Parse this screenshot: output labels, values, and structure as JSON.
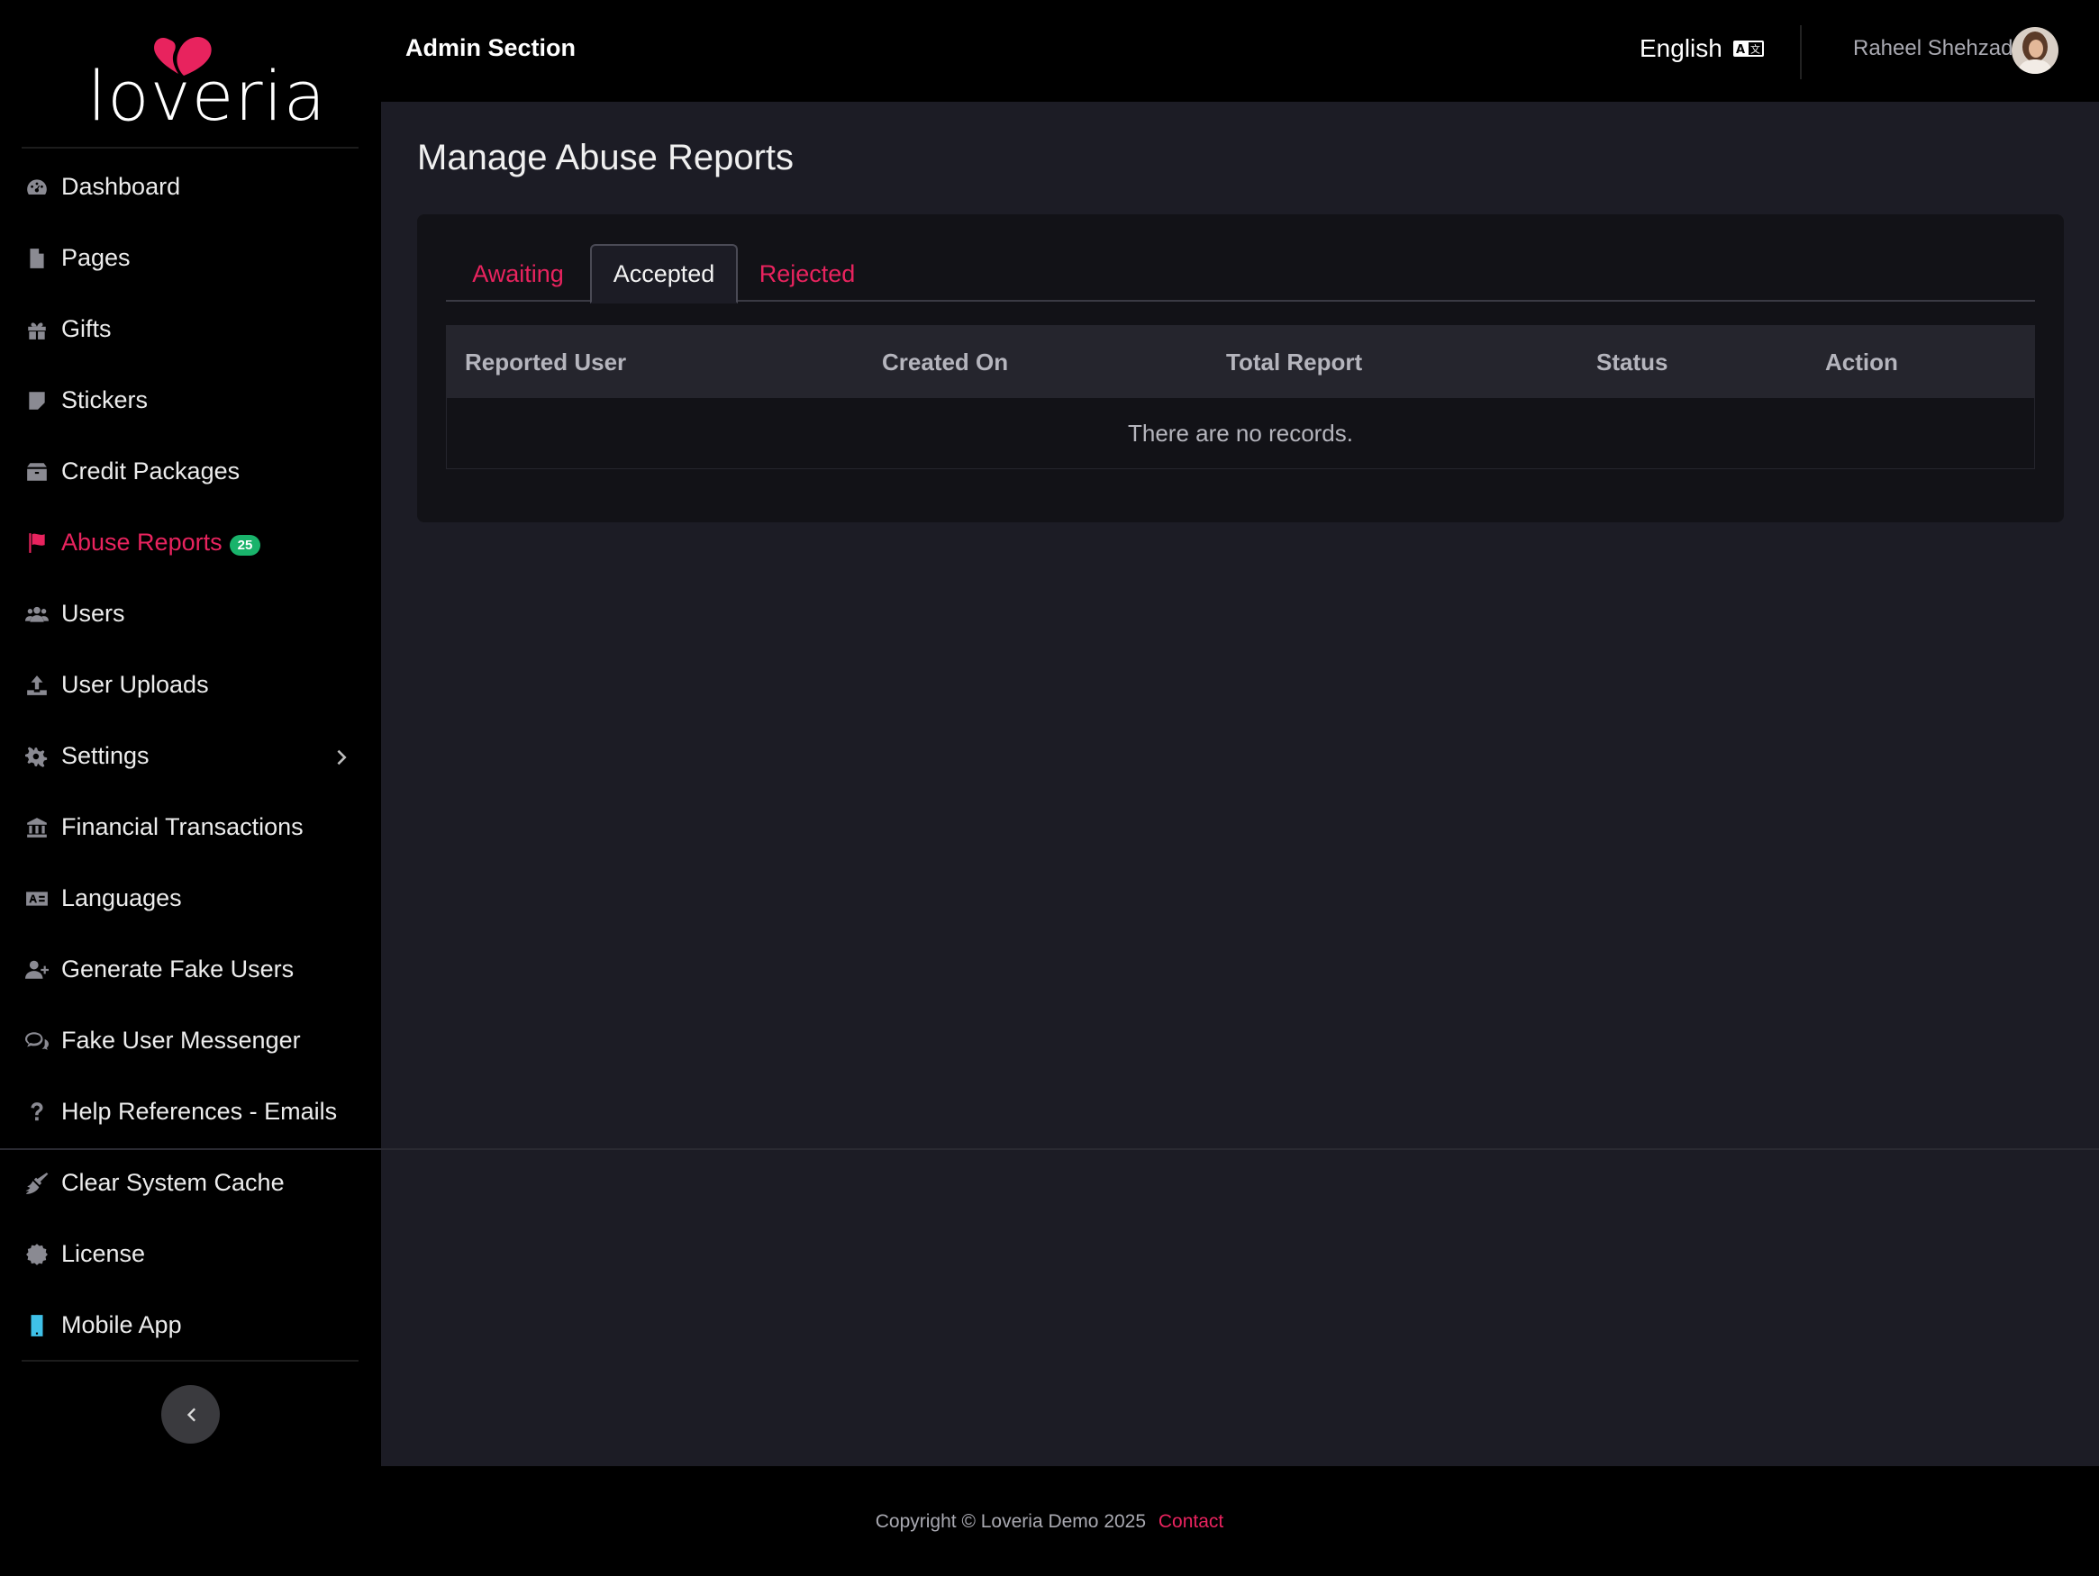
{
  "brand": {
    "logo_text": "loveria",
    "accent": "#e8235e",
    "badge_color": "#19b36b"
  },
  "header": {
    "title": "Admin Section",
    "language": "English",
    "user_name": "Raheel Shehzad"
  },
  "sidebar": {
    "items": [
      {
        "label": "Dashboard",
        "icon": "dashboard-icon"
      },
      {
        "label": "Pages",
        "icon": "file-icon"
      },
      {
        "label": "Gifts",
        "icon": "gift-icon"
      },
      {
        "label": "Stickers",
        "icon": "sticker-icon"
      },
      {
        "label": "Credit Packages",
        "icon": "box-icon"
      },
      {
        "label": "Abuse Reports",
        "icon": "flag-icon",
        "badge": "25",
        "active": true
      },
      {
        "label": "Users",
        "icon": "users-icon"
      },
      {
        "label": "User Uploads",
        "icon": "upload-icon"
      },
      {
        "label": "Settings",
        "icon": "gears-icon"
      },
      {
        "label": "Financial Transactions",
        "icon": "bank-icon"
      },
      {
        "label": "Languages",
        "icon": "language-icon"
      },
      {
        "label": "Generate Fake Users",
        "icon": "user-plus-icon"
      },
      {
        "label": "Fake User Messenger",
        "icon": "chat-icon"
      },
      {
        "label": "Help References - Emails",
        "icon": "question-icon"
      }
    ],
    "bottom_items": [
      {
        "label": "Clear System Cache",
        "icon": "broom-icon"
      },
      {
        "label": "License",
        "icon": "certificate-icon"
      },
      {
        "label": "Mobile App",
        "icon": "mobile-icon"
      }
    ]
  },
  "main": {
    "title": "Manage Abuse Reports",
    "tabs": [
      {
        "label": "Awaiting"
      },
      {
        "label": "Accepted",
        "active": true
      },
      {
        "label": "Rejected"
      }
    ],
    "table": {
      "columns": [
        "Reported User",
        "Created On",
        "Total Report",
        "Status",
        "Action"
      ],
      "empty_message": "There are no records."
    }
  },
  "footer": {
    "copyright": "Copyright © Loveria Demo 2025",
    "contact_label": "Contact"
  }
}
